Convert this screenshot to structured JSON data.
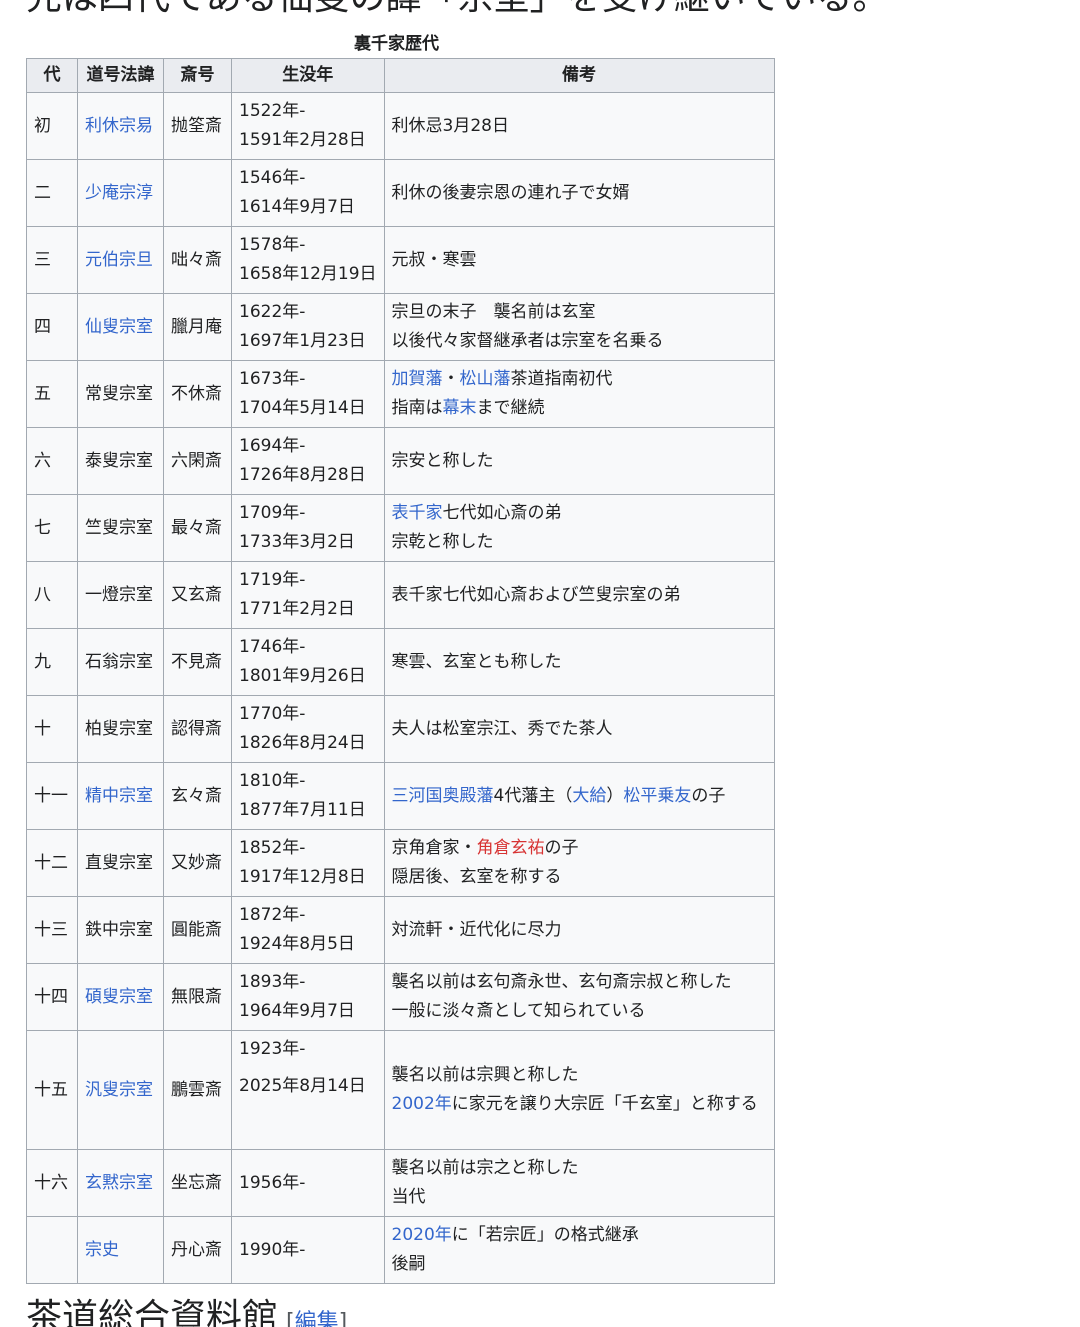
{
  "top_text": "先は四代である仙叟の諱「宗室」を受け継いでいる。",
  "table": {
    "caption": "裏千家歴代",
    "headers": [
      "代",
      "道号法諱",
      "斎号",
      "生没年",
      "備考"
    ],
    "rows": [
      {
        "gen": "初",
        "name": "利休宗易",
        "name_link": true,
        "saigo": "抛筌斎",
        "birth": "1522年-",
        "death": "1591年2月28日",
        "notes": [
          [
            {
              "t": "利休忌3月28日"
            }
          ]
        ]
      },
      {
        "gen": "二",
        "name": "少庵宗淳",
        "name_link": true,
        "saigo": "",
        "birth": "1546年-",
        "death": "1614年9月7日",
        "notes": [
          [
            {
              "t": "利休の後妻宗恩の連れ子で女婿"
            }
          ]
        ]
      },
      {
        "gen": "三",
        "name": "元伯宗旦",
        "name_link": true,
        "saigo": "咄々斎",
        "birth": "1578年-",
        "death": "1658年12月19日",
        "notes": [
          [
            {
              "t": "元叔・寒雲"
            }
          ]
        ]
      },
      {
        "gen": "四",
        "name": "仙叟宗室",
        "name_link": true,
        "saigo": "臘月庵",
        "birth": "1622年-",
        "death": "1697年1月23日",
        "notes": [
          [
            {
              "t": "宗旦の末子　襲名前は玄室"
            }
          ],
          [
            {
              "t": "以後代々家督継承者は宗室を名乗る"
            }
          ]
        ]
      },
      {
        "gen": "五",
        "name": "常叟宗室",
        "name_link": false,
        "saigo": "不休斎",
        "birth": "1673年-",
        "death": "1704年5月14日",
        "notes": [
          [
            {
              "t": "加賀藩",
              "link": true
            },
            {
              "t": "・"
            },
            {
              "t": "松山藩",
              "link": true
            },
            {
              "t": "茶道指南初代"
            }
          ],
          [
            {
              "t": "指南は"
            },
            {
              "t": "幕末",
              "link": true
            },
            {
              "t": "まで継続"
            }
          ]
        ]
      },
      {
        "gen": "六",
        "name": "泰叟宗室",
        "name_link": false,
        "saigo": "六閑斎",
        "birth": "1694年-",
        "death": "1726年8月28日",
        "notes": [
          [
            {
              "t": "宗安と称した"
            }
          ]
        ]
      },
      {
        "gen": "七",
        "name": "竺叟宗室",
        "name_link": false,
        "saigo": "最々斎",
        "birth": "1709年-",
        "death": "1733年3月2日",
        "notes": [
          [
            {
              "t": "表千家",
              "link": true
            },
            {
              "t": "七代如心斎の弟"
            }
          ],
          [
            {
              "t": "宗乾と称した"
            }
          ]
        ]
      },
      {
        "gen": "八",
        "name": "一燈宗室",
        "name_link": false,
        "saigo": "又玄斎",
        "birth": "1719年-",
        "death": "1771年2月2日",
        "notes": [
          [
            {
              "t": "表千家七代如心斎および竺叟宗室の弟"
            }
          ]
        ]
      },
      {
        "gen": "九",
        "name": "石翁宗室",
        "name_link": false,
        "saigo": "不見斎",
        "birth": "1746年-",
        "death": "1801年9月26日",
        "notes": [
          [
            {
              "t": "寒雲、玄室とも称した"
            }
          ]
        ]
      },
      {
        "gen": "十",
        "name": "柏叟宗室",
        "name_link": false,
        "saigo": "認得斎",
        "birth": "1770年-",
        "death": "1826年8月24日",
        "notes": [
          [
            {
              "t": "夫人は松室宗江、秀でた茶人"
            }
          ]
        ]
      },
      {
        "gen": "十一",
        "name": "精中宗室",
        "name_link": true,
        "saigo": "玄々斎",
        "birth": "1810年-",
        "death": "1877年7月11日",
        "notes": [
          [
            {
              "t": "三河国奥殿藩",
              "link": true
            },
            {
              "t": "4代藩主（"
            },
            {
              "t": "大給",
              "link": true
            },
            {
              "t": "）"
            },
            {
              "t": "松平乗友",
              "link": true
            },
            {
              "t": "の子"
            }
          ]
        ]
      },
      {
        "gen": "十二",
        "name": "直叟宗室",
        "name_link": false,
        "saigo": "又妙斎",
        "birth": "1852年-",
        "death": "1917年12月8日",
        "notes": [
          [
            {
              "t": "京角倉家・"
            },
            {
              "t": "角倉玄祐",
              "link": "new"
            },
            {
              "t": "の子"
            }
          ],
          [
            {
              "t": "隠居後、玄室を称する"
            }
          ]
        ]
      },
      {
        "gen": "十三",
        "name": "鉄中宗室",
        "name_link": false,
        "saigo": "圓能斎",
        "birth": "1872年-",
        "death": "1924年8月5日",
        "notes": [
          [
            {
              "t": "対流軒・近代化に尽力"
            }
          ]
        ]
      },
      {
        "gen": "十四",
        "name": "碩叟宗室",
        "name_link": true,
        "saigo": "無限斎",
        "birth": "1893年-",
        "death": "1964年9月7日",
        "notes": [
          [
            {
              "t": "襲名以前は玄句斎永世、玄句斎宗叔と称した"
            }
          ],
          [
            {
              "t": "一般に淡々斎として知られている"
            }
          ]
        ]
      },
      {
        "gen": "十五",
        "name": "汎叟宗室",
        "name_link": true,
        "saigo": "鵬雲斎",
        "birth": "1923年-",
        "death": "2025年8月14日",
        "tall": true,
        "notes": [
          [
            {
              "t": "襲名以前は宗興と称した"
            }
          ],
          [
            {
              "t": "2002年",
              "link": true
            },
            {
              "t": "に家元を譲り大宗匠「千玄室」と称する"
            }
          ]
        ]
      },
      {
        "gen": "十六",
        "name": "玄黙宗室",
        "name_link": true,
        "saigo": "坐忘斎",
        "birth": "1956年-",
        "death": "",
        "notes": [
          [
            {
              "t": "襲名以前は宗之と称した"
            }
          ],
          [
            {
              "t": "当代"
            }
          ]
        ]
      },
      {
        "gen": "",
        "name": "宗史",
        "name_link": true,
        "saigo": "丹心斎",
        "birth": "1990年-",
        "death": "",
        "notes": [
          [
            {
              "t": "2020年",
              "link": true
            },
            {
              "t": "に「若宗匠」の格式継承"
            }
          ],
          [
            {
              "t": "後嗣"
            }
          ]
        ]
      }
    ]
  },
  "section": {
    "heading": "茶道総合資料館",
    "edit_open": "[",
    "edit_label": "編集",
    "edit_close": "]"
  }
}
